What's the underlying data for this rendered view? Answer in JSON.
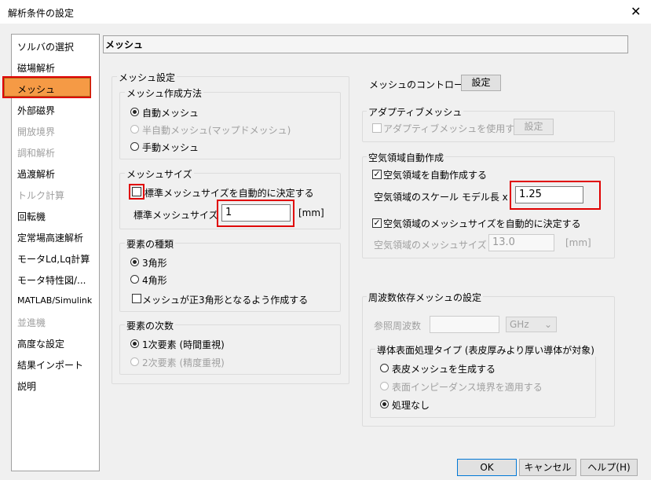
{
  "window": {
    "title": "解析条件の設定",
    "close": "✕"
  },
  "nav": {
    "items": [
      {
        "label": "ソルバの選択",
        "disabled": false
      },
      {
        "label": "磁場解析",
        "disabled": false
      },
      {
        "label": "メッシュ",
        "disabled": false,
        "selected": true
      },
      {
        "label": "外部磁界",
        "disabled": false
      },
      {
        "label": "開放境界",
        "disabled": true
      },
      {
        "label": "調和解析",
        "disabled": true
      },
      {
        "label": "過渡解析",
        "disabled": false
      },
      {
        "label": "トルク計算",
        "disabled": true
      },
      {
        "label": "回転機",
        "disabled": false
      },
      {
        "label": "定常場高速解析",
        "disabled": false
      },
      {
        "label": "モータLd,Lq計算",
        "disabled": false
      },
      {
        "label": "モータ特性図/...",
        "disabled": false
      },
      {
        "label": "MATLAB/Simulink",
        "disabled": false
      },
      {
        "label": "並進機",
        "disabled": true
      },
      {
        "label": "高度な設定",
        "disabled": false
      },
      {
        "label": "結果インポート",
        "disabled": false
      },
      {
        "label": "説明",
        "disabled": false
      }
    ]
  },
  "header": {
    "title": "メッシュ"
  },
  "mesh_settings": {
    "group_title": "メッシュ設定",
    "method": {
      "title": "メッシュ作成方法",
      "auto": "自動メッシュ",
      "semi": "半自動メッシュ(マップドメッシュ)",
      "manual": "手動メッシュ"
    },
    "size": {
      "title": "メッシュサイズ",
      "auto_check": "標準メッシュサイズを自動的に決定する",
      "standard_label": "標準メッシュサイズ",
      "standard_value": "1",
      "unit": "[mm]"
    },
    "element_type": {
      "title": "要素の種類",
      "tri": "3角形",
      "quad": "4角形",
      "regular_check": "メッシュが正3角形となるよう作成する"
    },
    "element_order": {
      "title": "要素の次数",
      "first": "1次要素 (時間重視)",
      "second": "2次要素 (精度重視)"
    }
  },
  "control": {
    "label": "メッシュのコントロール",
    "button": "設定"
  },
  "adaptive": {
    "title": "アダプティブメッシュ",
    "check": "アダプティブメッシュを使用する",
    "button": "設定"
  },
  "air": {
    "title": "空気領域自動作成",
    "auto_check": "空気領域を自動作成する",
    "scale_label": "空気領域のスケール モデル長 x",
    "scale_value": "1.25",
    "size_check": "空気領域のメッシュサイズを自動的に決定する",
    "size_label": "空気領域のメッシュサイズ",
    "size_value": "13.0",
    "size_unit": "[mm]"
  },
  "freq": {
    "title": "周波数依存メッシュの設定",
    "ref_label": "参照周波数",
    "ref_value": "",
    "unit": "GHz",
    "conductor": {
      "title": "導体表面処理タイプ (表皮厚みより厚い導体が対象)",
      "skin": "表皮メッシュを生成する",
      "impedance": "表面インピーダンス境界を適用する",
      "none": "処理なし"
    }
  },
  "buttons": {
    "ok": "OK",
    "cancel": "キャンセル",
    "help": "ヘルプ(H)"
  },
  "colors": {
    "highlight_red": "#e00000",
    "nav_selected": "#f59a45"
  }
}
